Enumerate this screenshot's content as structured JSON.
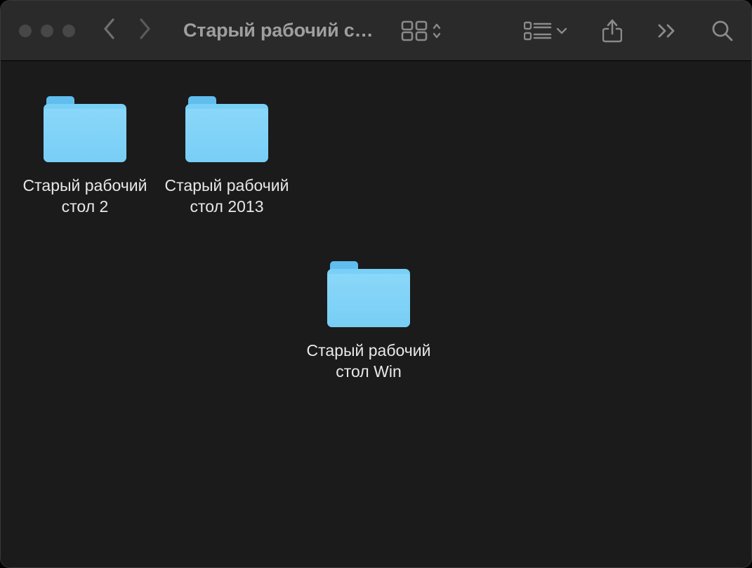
{
  "window": {
    "title": "Старый рабочий с…"
  },
  "toolbar": {
    "nav_back": "Назад",
    "nav_forward": "Вперёд",
    "view_icons": "Значки",
    "group": "Группировать",
    "share": "Поделиться",
    "more": "Ещё",
    "search": "Поиск"
  },
  "items": [
    {
      "name": "Старый рабочий стол 2"
    },
    {
      "name": "Старый рабочий стол 2013"
    },
    {
      "name": "Старый рабочий стол Win"
    }
  ],
  "colors": {
    "folder": "#7dd0f7",
    "bg": "#1b1b1b",
    "titlebar": "#2a2a2a",
    "text": "#e8e8e8",
    "icon_inactive": "#8a8a8b"
  }
}
